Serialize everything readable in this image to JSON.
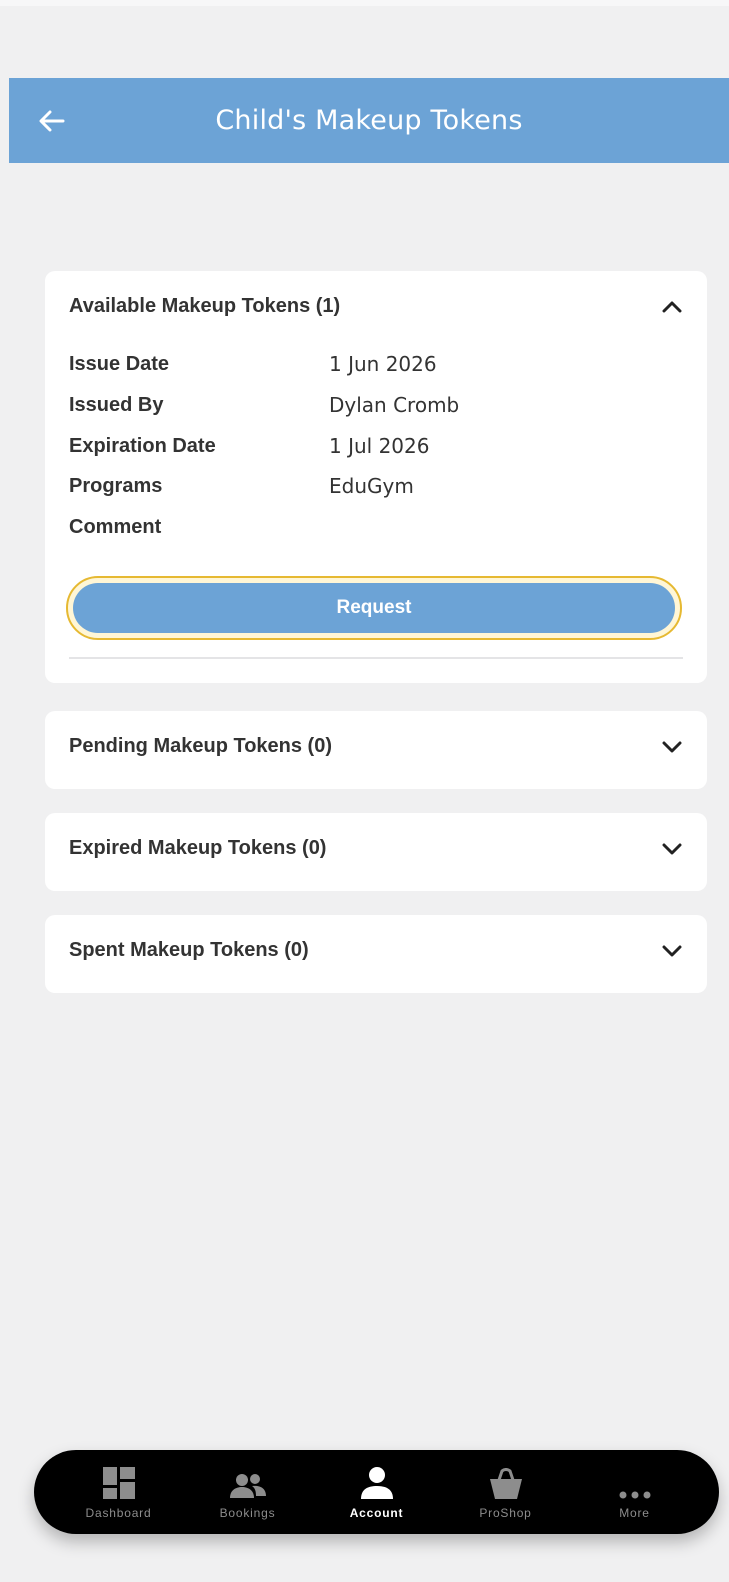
{
  "header": {
    "title": "Child's Makeup Tokens"
  },
  "sections": {
    "available": {
      "title": "Available Makeup Tokens (1)",
      "rows": [
        {
          "label": "Issue Date",
          "value": "1 Jun 2026"
        },
        {
          "label": "Issued By",
          "value": "Dylan Cromb"
        },
        {
          "label": "Expiration Date",
          "value": "1 Jul 2026"
        },
        {
          "label": "Programs",
          "value": "EduGym"
        },
        {
          "label": "Comment",
          "value": ""
        }
      ],
      "request_label": "Request"
    },
    "pending": {
      "title": "Pending Makeup Tokens (0)"
    },
    "expired": {
      "title": "Expired Makeup Tokens (0)"
    },
    "spent": {
      "title": "Spent Makeup Tokens (0)"
    }
  },
  "nav": {
    "items": [
      {
        "label": "Dashboard",
        "icon": "dashboard-icon"
      },
      {
        "label": "Bookings",
        "icon": "people-icon"
      },
      {
        "label": "Account",
        "icon": "person-icon",
        "active": true
      },
      {
        "label": "ProShop",
        "icon": "basket-icon"
      },
      {
        "label": "More",
        "icon": "more-icon"
      }
    ]
  },
  "colors": {
    "header": "#6ca3d6",
    "button": "#6ca3d6",
    "focus_ring": "#e6b932",
    "background": "#f0f0f1",
    "navbar": "#000000"
  }
}
